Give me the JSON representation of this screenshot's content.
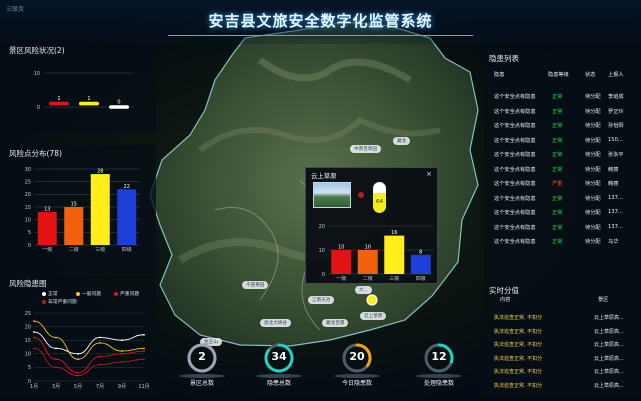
{
  "window": {
    "corner_label": "三级页"
  },
  "header": {
    "title": "安吉县文旅安全数字化监管系统"
  },
  "panels": {
    "scenic_risk": {
      "title": "景区风险状况(2)",
      "chart_data": {
        "type": "bar",
        "categories": [
          "",
          "",
          ""
        ],
        "values": [
          1,
          1,
          0
        ],
        "colors": [
          "#e41313",
          "#ffee1a",
          "#ffffff"
        ],
        "ylim": [
          0,
          10
        ],
        "yticks": [
          0,
          10
        ]
      }
    },
    "risk_distribution": {
      "title": "风险点分布(78)",
      "chart_data": {
        "type": "bar",
        "categories": [
          "一级",
          "二级",
          "三级",
          "四级"
        ],
        "values": [
          13,
          15,
          28,
          22
        ],
        "colors": [
          "#e41313",
          "#f2620c",
          "#ffee1a",
          "#1f3fd9"
        ],
        "ylim": [
          0,
          30
        ],
        "yticks": [
          0,
          5,
          10,
          15,
          20,
          25,
          30
        ]
      }
    },
    "risk_hidden": {
      "title": "风险隐患图",
      "legend": [
        {
          "label": "正常",
          "color": "#ffffff"
        },
        {
          "label": "一般问题",
          "color": "#f2c41a"
        },
        {
          "label": "严重问题",
          "color": "#e41313"
        },
        {
          "label": "非常严重问题",
          "color": "#b21d1d"
        }
      ],
      "chart_data": {
        "type": "line",
        "x": [
          "1月",
          "3月",
          "5月",
          "7月",
          "9月",
          "11月"
        ],
        "ylim": [
          0,
          25
        ],
        "yticks": [
          0,
          5,
          10,
          15,
          20,
          25
        ],
        "series": [
          {
            "color": "#ffffff",
            "values": [
              18,
              12,
              10,
              16,
              15,
              17
            ]
          },
          {
            "color": "#f2c41a",
            "values": [
              22,
              16,
              8,
              14,
              11,
              12
            ]
          },
          {
            "color": "#e41313",
            "values": [
              16,
              8,
              3,
              9,
              10,
              11
            ]
          },
          {
            "color": "#b21d1d",
            "values": [
              12,
              5,
              2,
              6,
              7,
              8
            ]
          }
        ]
      }
    },
    "hazard_list": {
      "title": "隐患列表",
      "columns": [
        "隐患",
        "隐患等级",
        "状态",
        "上报人"
      ],
      "rows": [
        {
          "name": "这个安全点有隐患",
          "level": "正常",
          "level_type": "g",
          "status": "待分配",
          "reporter": "李焰成"
        },
        {
          "name": "这个安全点有隐患",
          "level": "正常",
          "level_type": "g",
          "status": "待分配",
          "reporter": "罗正玲"
        },
        {
          "name": "这个安全点有隐患",
          "level": "正常",
          "level_type": "g",
          "status": "待分配",
          "reporter": "孙怡阳"
        },
        {
          "name": "这个安全点有隐患",
          "level": "正常",
          "level_type": "g",
          "status": "待分配",
          "reporter": "150..."
        },
        {
          "name": "这个安全点有隐患",
          "level": "正常",
          "level_type": "g",
          "status": "待分配",
          "reporter": "张永平"
        },
        {
          "name": "这个安全点有隐患",
          "level": "正常",
          "level_type": "g",
          "status": "待分配",
          "reporter": "韩丽"
        },
        {
          "name": "这个安全点有隐患",
          "level": "严重",
          "level_type": "r",
          "status": "待分配",
          "reporter": "韩丽"
        },
        {
          "name": "这个安全点有隐患",
          "level": "正常",
          "level_type": "g",
          "status": "待分配",
          "reporter": "137..."
        },
        {
          "name": "这个安全点有隐患",
          "level": "正常",
          "level_type": "g",
          "status": "待分配",
          "reporter": "137..."
        },
        {
          "name": "这个安全点有隐患",
          "level": "正常",
          "level_type": "g",
          "status": "待分配",
          "reporter": "137..."
        },
        {
          "name": "这个安全点有隐患",
          "level": "正常",
          "level_type": "g",
          "status": "待分配",
          "reporter": "马华"
        }
      ]
    },
    "realtime_score": {
      "title": "实时分值",
      "columns": [
        "内容",
        "景区"
      ],
      "rows": [
        {
          "content": "执法巡查正常, 不扣分",
          "area": "云上草原高..."
        },
        {
          "content": "执法巡查正常, 不扣分",
          "area": "云上草原高..."
        },
        {
          "content": "执法巡查正常, 不扣分",
          "area": "云上草原高..."
        },
        {
          "content": "执法巡查正常, 不扣分",
          "area": "云上草原高..."
        },
        {
          "content": "执法巡查正常, 不扣分",
          "area": "云上草原高..."
        },
        {
          "content": "执法巡查正常, 不扣分",
          "area": "云上草原高..."
        }
      ]
    }
  },
  "map": {
    "places": [
      "中南百草园",
      "藏龙",
      "千亩茶园",
      "江南天池",
      "浙北大峡谷",
      "藏龙百瀑",
      "龙王山",
      "大...",
      "云上草原"
    ]
  },
  "popup": {
    "title": "云上草原",
    "close": "×",
    "pill_value": "64",
    "chart_data": {
      "type": "bar",
      "categories": [
        "一级",
        "二级",
        "三级",
        "四级"
      ],
      "values": [
        10,
        10,
        16,
        8
      ],
      "colors": [
        "#e41313",
        "#f2620c",
        "#ffee1a",
        "#1f3fd9"
      ],
      "ylim": [
        0,
        20
      ],
      "yticks": [
        0,
        10,
        20
      ]
    }
  },
  "kpis": [
    {
      "value": "2",
      "label": "景区总数",
      "ring_color": "#9aa6b2",
      "fraction": 1.0
    },
    {
      "value": "34",
      "label": "隐患总数",
      "ring_color": "#22d0c4",
      "fraction": 0.85
    },
    {
      "value": "20",
      "label": "今日隐患数",
      "ring_color": "#f2a01a",
      "fraction": 0.35
    },
    {
      "value": "12",
      "label": "处理隐患数",
      "ring_color": "#22d0c4",
      "fraction": 0.3
    }
  ]
}
